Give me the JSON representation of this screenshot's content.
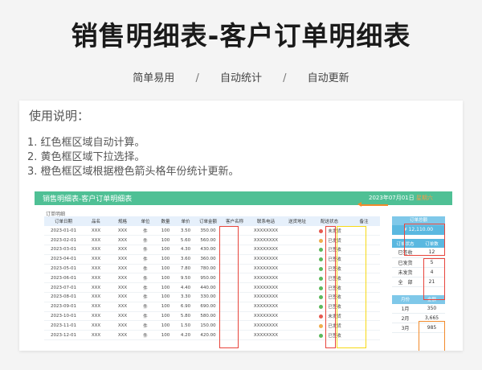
{
  "page": {
    "title": "销售明细表-客户订单明细表",
    "features": [
      "简单易用",
      "自动统计",
      "自动更新"
    ],
    "separator": "/"
  },
  "instructions": {
    "title": "使用说明：",
    "items": [
      "1. 红色框区域自动计算。",
      "2. 黄色框区域下拉选择。",
      "3. 橙色框区域根据橙色箭头格年份统计更新。"
    ]
  },
  "sheet": {
    "title": "销售明细表-客户订单明细表",
    "date_prefix": "2023年07月01日",
    "date_suffix": "星期六",
    "section_label": "订单明细",
    "columns": [
      "订单日期",
      "品名",
      "规格",
      "单位",
      "数量",
      "单价",
      "订单金额",
      "客户名称",
      "联系电话",
      "送货地址",
      "配送状态",
      "备注"
    ],
    "rows": [
      {
        "date": "2023-01-01",
        "name": "XXX",
        "spec": "XXX",
        "unit": "件",
        "qty": "100",
        "price": "3.50",
        "amount": "350.00",
        "phone": "XXXXXXXX",
        "status": "未发货",
        "status_color": "#e6594f"
      },
      {
        "date": "2023-02-01",
        "name": "XXX",
        "spec": "XXX",
        "unit": "件",
        "qty": "100",
        "price": "5.60",
        "amount": "560.00",
        "phone": "XXXXXXXX",
        "status": "已发货",
        "status_color": "#f0ad4e"
      },
      {
        "date": "2023-03-01",
        "name": "XXX",
        "spec": "XXX",
        "unit": "件",
        "qty": "100",
        "price": "4.30",
        "amount": "430.00",
        "phone": "XXXXXXXX",
        "status": "已签收",
        "status_color": "#5cb85c"
      },
      {
        "date": "2023-04-01",
        "name": "XXX",
        "spec": "XXX",
        "unit": "件",
        "qty": "100",
        "price": "3.60",
        "amount": "360.00",
        "phone": "XXXXXXXX",
        "status": "已签收",
        "status_color": "#5cb85c"
      },
      {
        "date": "2023-05-01",
        "name": "XXX",
        "spec": "XXX",
        "unit": "件",
        "qty": "100",
        "price": "7.80",
        "amount": "780.00",
        "phone": "XXXXXXXX",
        "status": "已签收",
        "status_color": "#5cb85c"
      },
      {
        "date": "2023-06-01",
        "name": "XXX",
        "spec": "XXX",
        "unit": "件",
        "qty": "100",
        "price": "9.50",
        "amount": "950.00",
        "phone": "XXXXXXXX",
        "status": "已签收",
        "status_color": "#5cb85c"
      },
      {
        "date": "2023-07-01",
        "name": "XXX",
        "spec": "XXX",
        "unit": "件",
        "qty": "100",
        "price": "4.40",
        "amount": "440.00",
        "phone": "XXXXXXXX",
        "status": "已签收",
        "status_color": "#5cb85c"
      },
      {
        "date": "2023-08-01",
        "name": "XXX",
        "spec": "XXX",
        "unit": "件",
        "qty": "100",
        "price": "3.30",
        "amount": "330.00",
        "phone": "XXXXXXXX",
        "status": "已签收",
        "status_color": "#5cb85c"
      },
      {
        "date": "2023-09-01",
        "name": "XXX",
        "spec": "XXX",
        "unit": "件",
        "qty": "100",
        "price": "6.90",
        "amount": "690.00",
        "phone": "XXXXXXXX",
        "status": "已签收",
        "status_color": "#5cb85c"
      },
      {
        "date": "2023-10-01",
        "name": "XXX",
        "spec": "XXX",
        "unit": "件",
        "qty": "100",
        "price": "5.80",
        "amount": "580.00",
        "phone": "XXXXXXXX",
        "status": "未发货",
        "status_color": "#e6594f"
      },
      {
        "date": "2023-11-01",
        "name": "XXX",
        "spec": "XXX",
        "unit": "件",
        "qty": "100",
        "price": "1.50",
        "amount": "150.00",
        "phone": "XXXXXXXX",
        "status": "已发货",
        "status_color": "#f0ad4e"
      },
      {
        "date": "2023-12-01",
        "name": "XXX",
        "spec": "XXX",
        "unit": "件",
        "qty": "100",
        "price": "4.20",
        "amount": "420.00",
        "phone": "XXXXXXXX",
        "status": "已签收",
        "status_color": "#5cb85c"
      }
    ]
  },
  "summary": {
    "total_label": "订单总额",
    "total_value": "¥ 12,110.00",
    "status_headers": [
      "订单状态",
      "订单数"
    ],
    "status_rows": [
      {
        "label": "已签收",
        "count": "12"
      },
      {
        "label": "已发货",
        "count": "5"
      },
      {
        "label": "未发货",
        "count": "4"
      },
      {
        "label": "全　部",
        "count": "21"
      }
    ],
    "month_headers": [
      "月份",
      "金额"
    ],
    "month_rows": [
      {
        "month": "1月",
        "amount": "350"
      },
      {
        "month": "2月",
        "amount": "3,665"
      },
      {
        "month": "3月",
        "amount": "985"
      }
    ]
  }
}
